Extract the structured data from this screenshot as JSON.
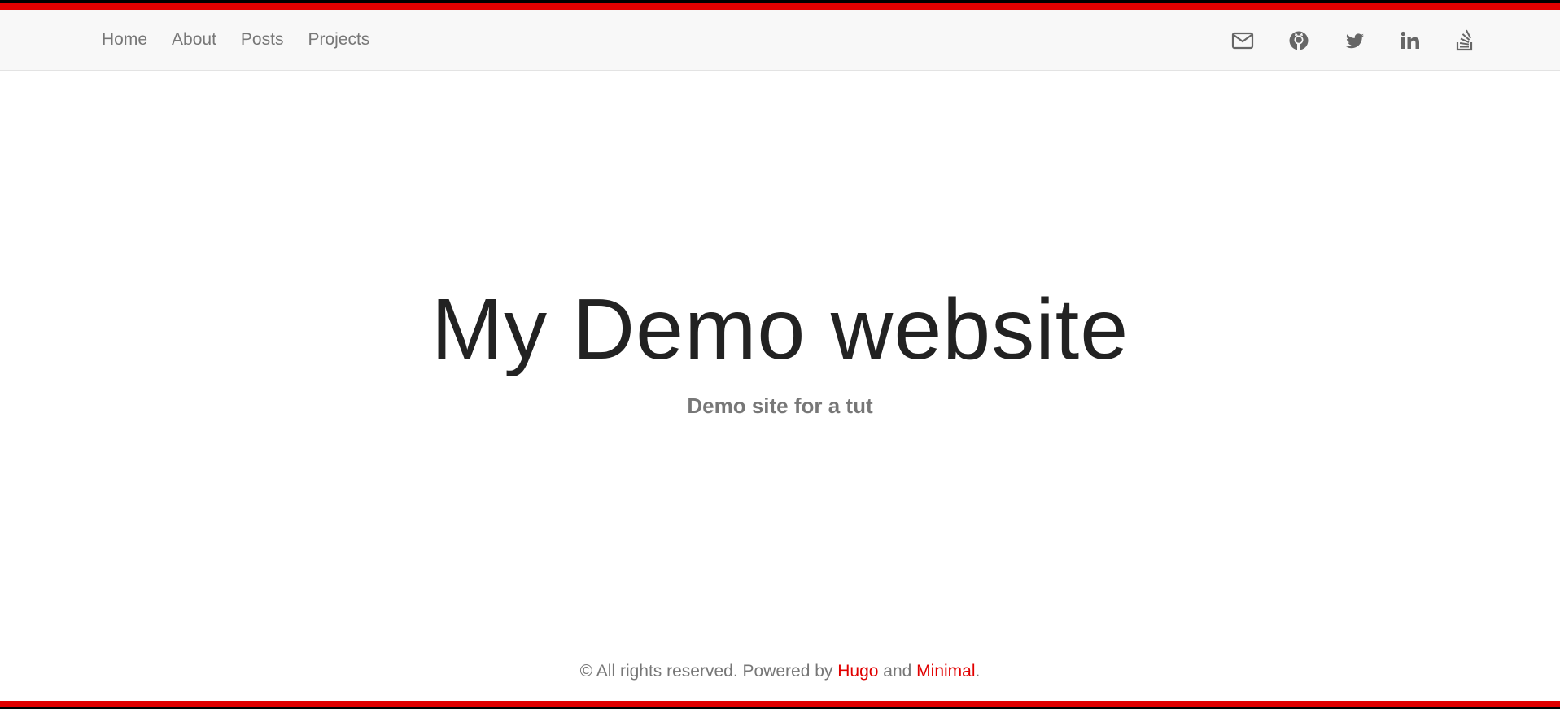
{
  "colors": {
    "accent": "#e10000",
    "nav_background": "#f8f8f8",
    "nav_text": "#777777",
    "title_text": "#222222",
    "subtitle_text": "#777777"
  },
  "nav": {
    "links": [
      {
        "label": "Home"
      },
      {
        "label": "About"
      },
      {
        "label": "Posts"
      },
      {
        "label": "Projects"
      }
    ],
    "social": [
      {
        "icon": "mail-icon"
      },
      {
        "icon": "github-icon"
      },
      {
        "icon": "twitter-icon"
      },
      {
        "icon": "linkedin-icon"
      },
      {
        "icon": "stackoverflow-icon"
      }
    ]
  },
  "hero": {
    "title": "My Demo website",
    "subtitle": "Demo site for a tut"
  },
  "footer": {
    "prefix": "© All rights reserved. Powered by ",
    "hugo_link": "Hugo",
    "middle": " and ",
    "minimal_link": "Minimal",
    "suffix": "."
  }
}
